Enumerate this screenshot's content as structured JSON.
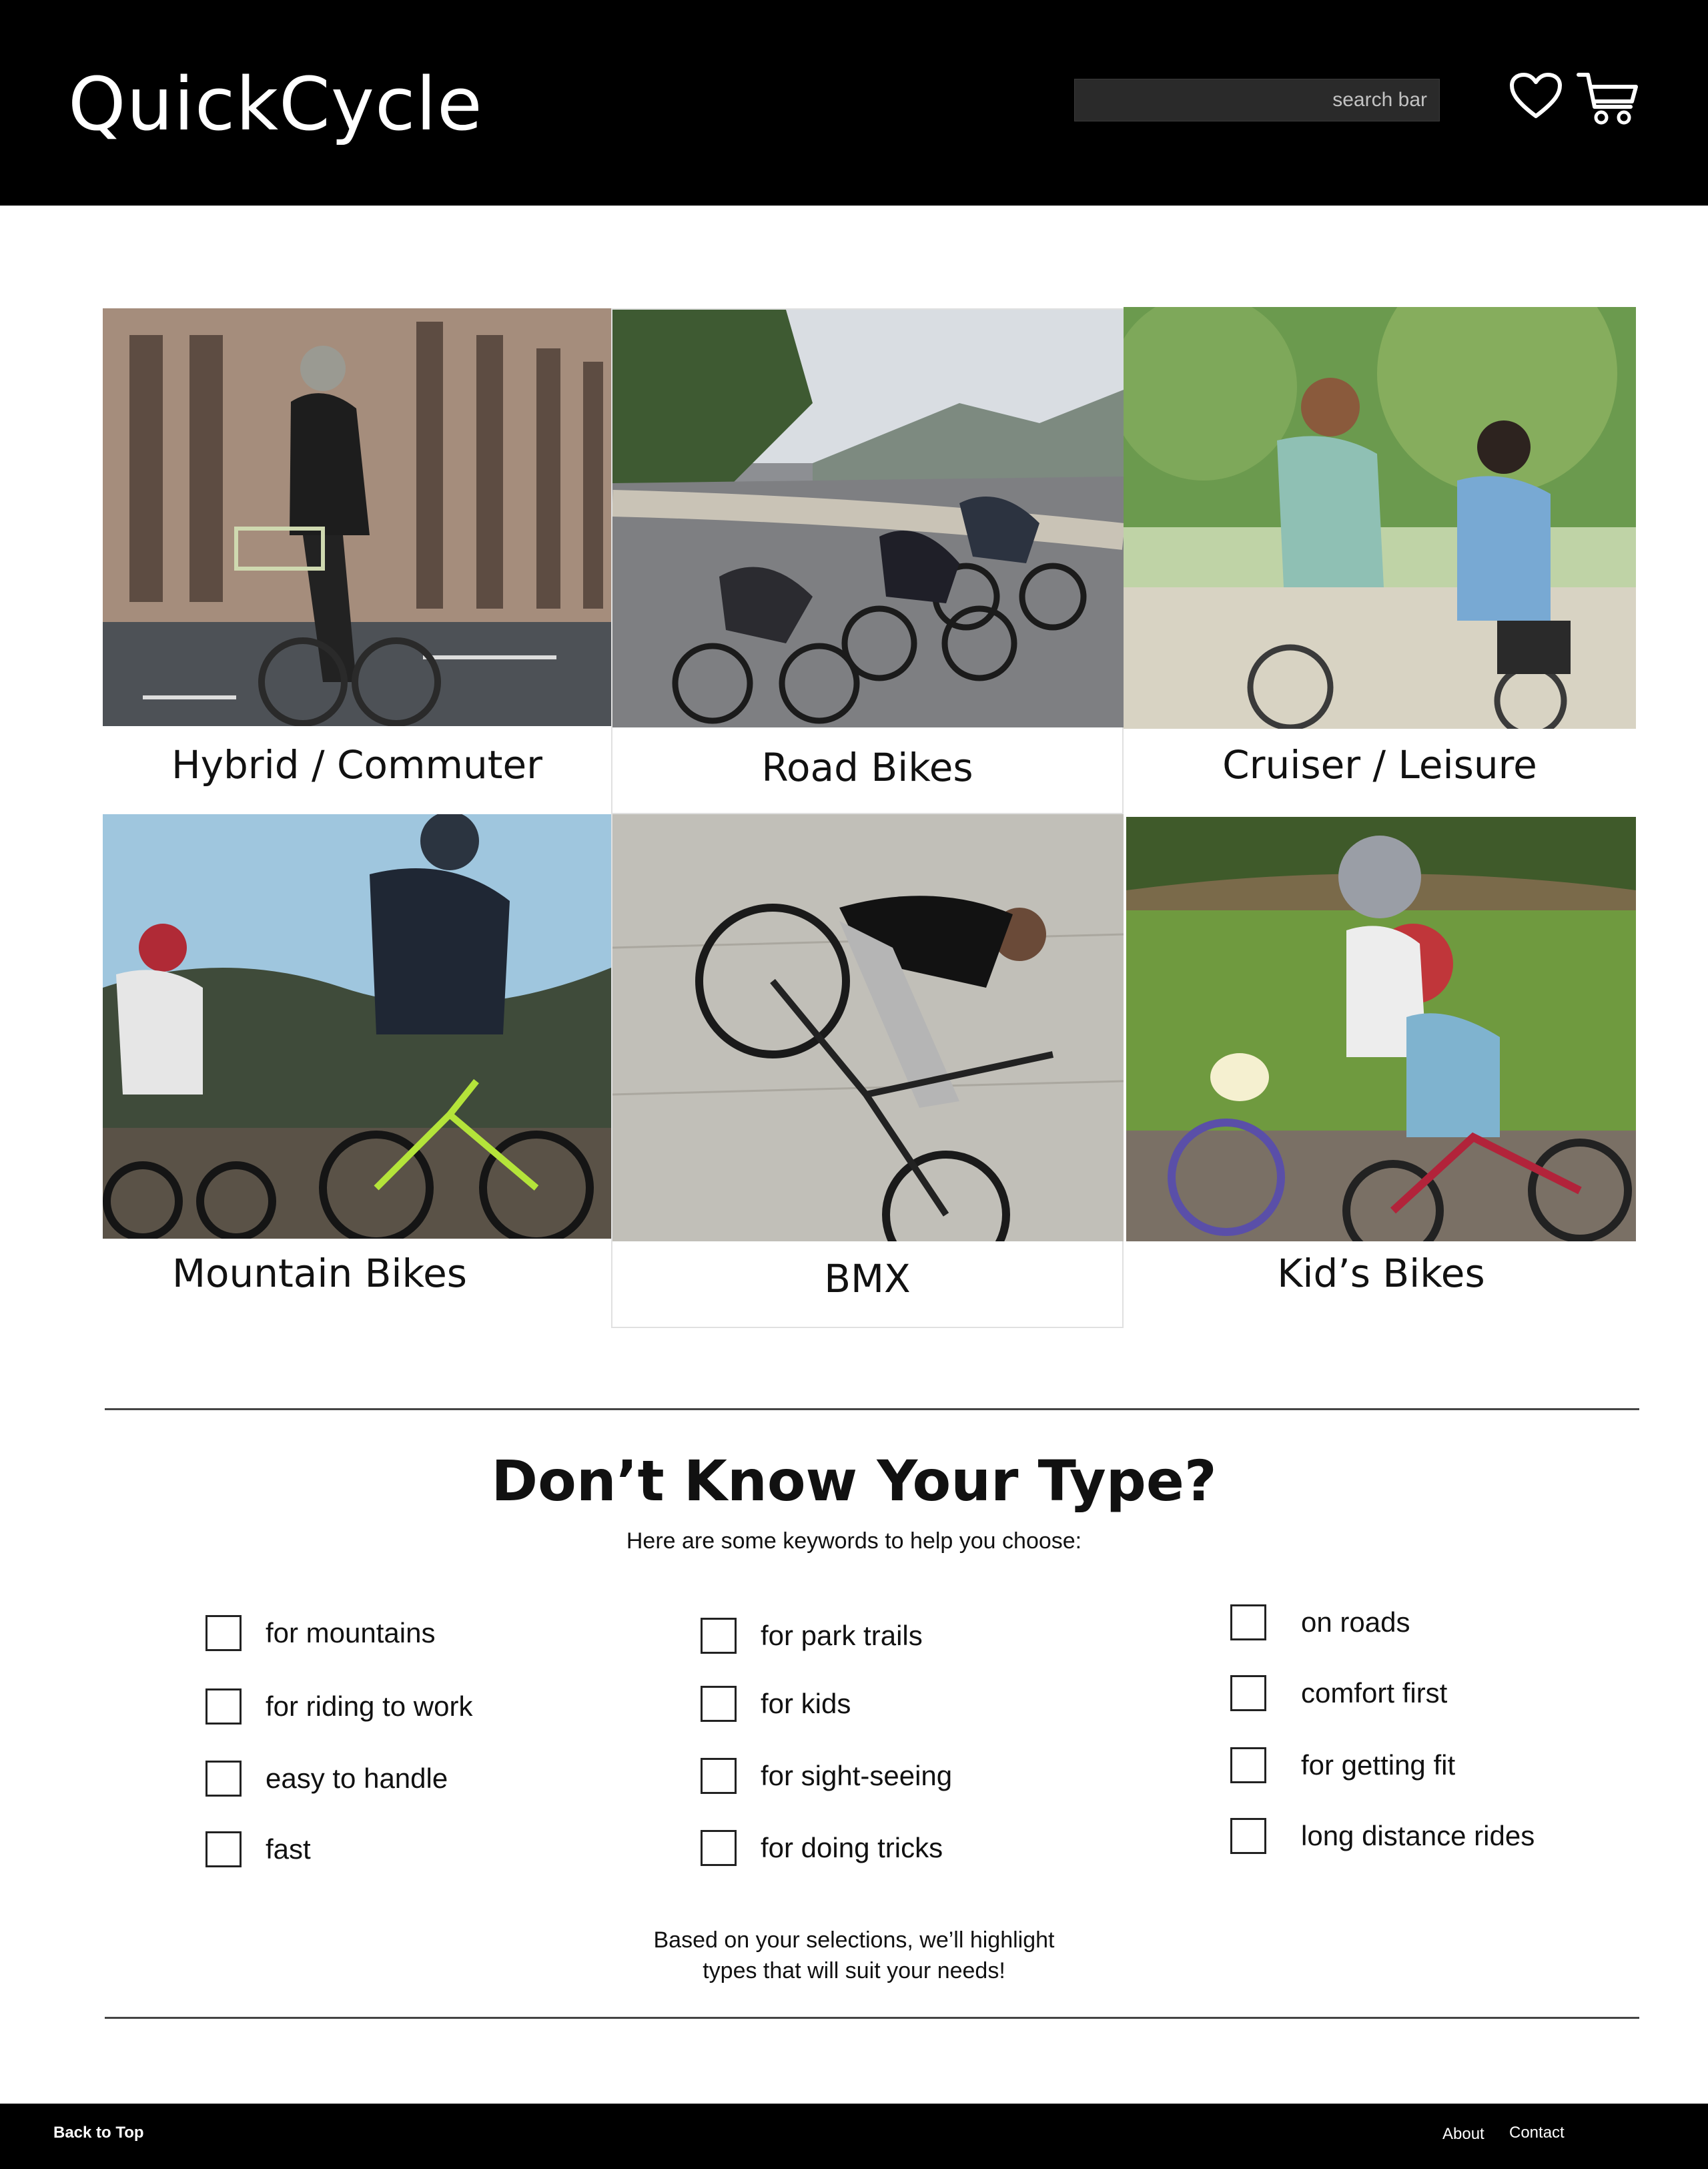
{
  "header": {
    "brand": "QuickCycle",
    "search_placeholder": "search bar",
    "icons": [
      "heart-icon",
      "cart-icon"
    ]
  },
  "categories": [
    {
      "label": "Hybrid / Commuter"
    },
    {
      "label": "Road Bikes"
    },
    {
      "label": "Cruiser / Leisure"
    },
    {
      "label": "Mountain Bikes"
    },
    {
      "label": "BMX"
    },
    {
      "label": "Kid’s Bikes"
    }
  ],
  "helper": {
    "title": "Don’t Know Your Type?",
    "subtitle": "Here are some keywords to help you choose:",
    "keywords": [
      [
        "for mountains",
        "for riding to work",
        "easy to handle",
        "fast"
      ],
      [
        "for park trails",
        "for kids",
        "for sight-seeing",
        "for doing tricks"
      ],
      [
        "on roads",
        "comfort first",
        "for getting fit",
        "long distance rides"
      ]
    ],
    "note_line1": "Based on your selections, we’ll highlight",
    "note_line2": "types that will suit your needs!"
  },
  "footer": {
    "back_to_top": "Back to Top",
    "about": "About",
    "contact": "Contact"
  },
  "colors": {
    "header_bg": "#000000",
    "footer_bg": "#000000",
    "text": "#111111"
  }
}
